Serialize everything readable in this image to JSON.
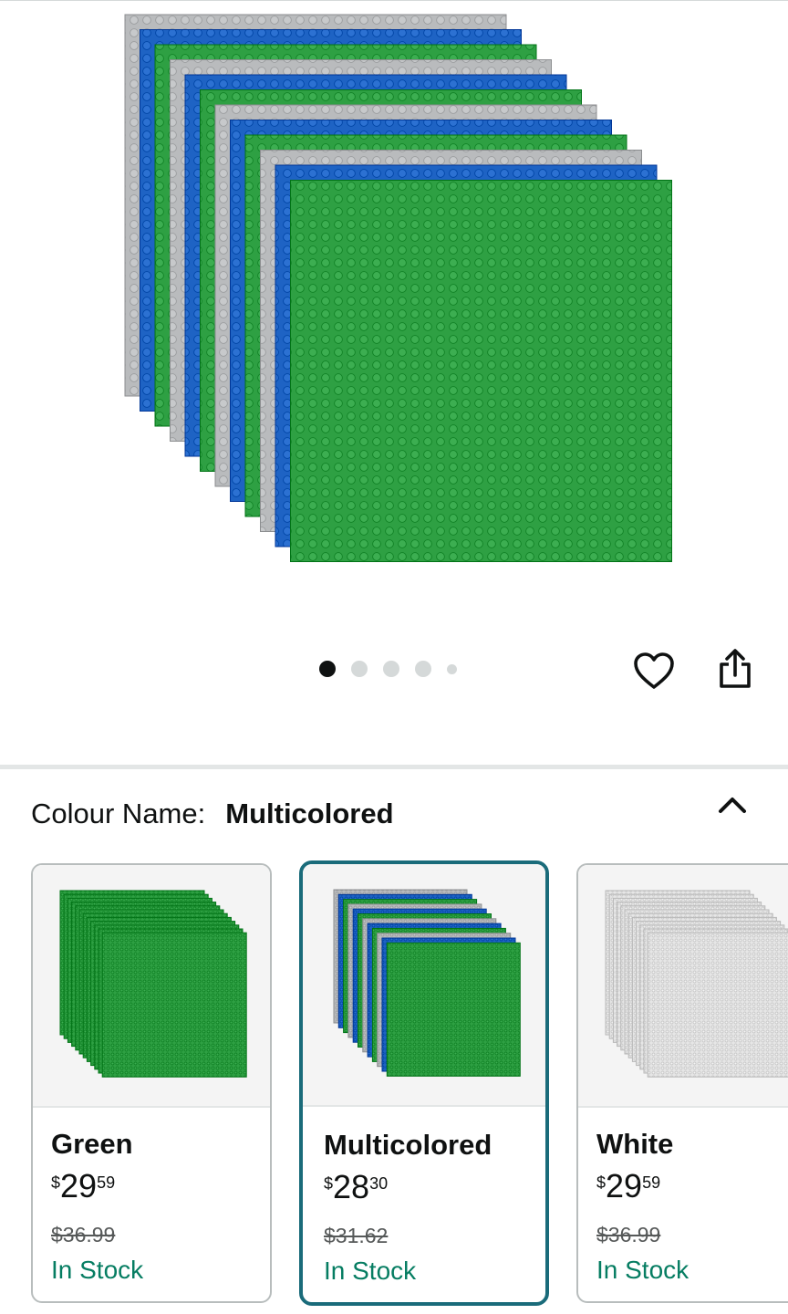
{
  "product": {
    "image_icon": "multicolor-baseplates-image",
    "carousel": {
      "total": 5,
      "active_index": 0
    }
  },
  "actions": {
    "wishlist_icon": "heart-icon",
    "share_icon": "share-icon"
  },
  "colour": {
    "label": "Colour Name:",
    "selected": "Multicolored",
    "collapse_icon": "chevron-up-icon"
  },
  "variants": [
    {
      "name": "Green",
      "currency": "$",
      "price_whole": "29",
      "price_fraction": "59",
      "was_price": "$36.99",
      "stock": "In Stock",
      "selected": false,
      "thumb_color": "#2ea043"
    },
    {
      "name": "Multicolored",
      "currency": "$",
      "price_whole": "28",
      "price_fraction": "30",
      "was_price": "$31.62",
      "stock": "In Stock",
      "selected": true,
      "thumb_color": "multi"
    },
    {
      "name": "White",
      "currency": "$",
      "price_whole": "29",
      "price_fraction": "59",
      "was_price": "$36.99",
      "stock": "In Stock",
      "selected": false,
      "thumb_color": "#e6e6e6"
    }
  ],
  "colors": {
    "green": "#2ea043",
    "blue": "#1e63c4",
    "gray": "#b9bbbd",
    "stock_green": "#067d62",
    "selected_border": "#1a6b7a"
  }
}
